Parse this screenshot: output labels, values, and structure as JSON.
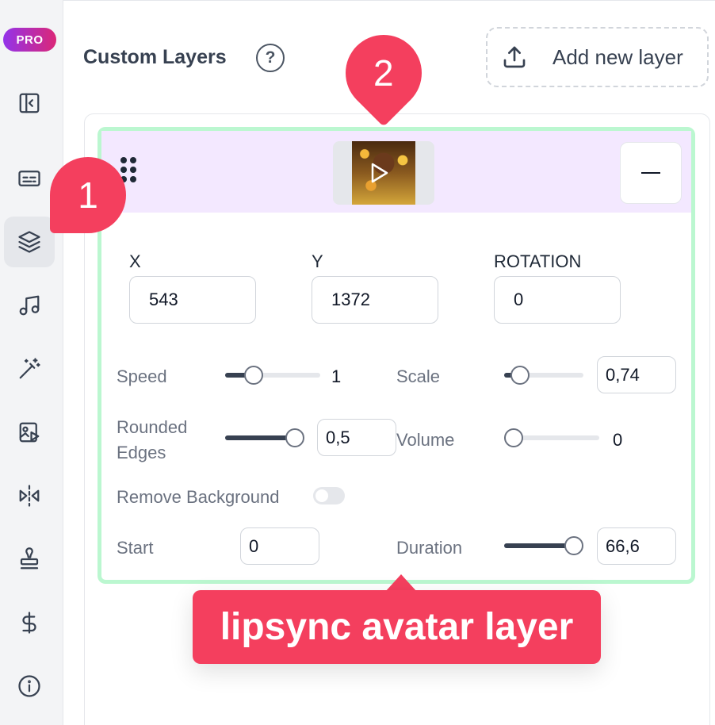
{
  "sidebar": {
    "pro_badge": "PRO",
    "items": [
      {
        "name": "sidebar-toggle-icon"
      },
      {
        "name": "subtitles-icon"
      },
      {
        "name": "layers-icon",
        "active": true
      },
      {
        "name": "music-icon"
      },
      {
        "name": "magic-wand-icon"
      },
      {
        "name": "video-image-icon"
      },
      {
        "name": "flip-icon"
      },
      {
        "name": "stamp-icon"
      },
      {
        "name": "dollar-icon"
      },
      {
        "name": "info-icon"
      }
    ]
  },
  "header": {
    "title": "Custom Layers",
    "help_glyph": "?",
    "add_button_label": "Add new layer"
  },
  "layer": {
    "fields": {
      "x_label": "X",
      "x_value": "543",
      "y_label": "Y",
      "y_value": "1372",
      "rotation_label": "ROTATION",
      "rotation_value": "0",
      "speed_label": "Speed",
      "speed_value": "1",
      "scale_label": "Scale",
      "scale_value": "0,74",
      "rounded_label_1": "Rounded",
      "rounded_label_2": "Edges",
      "rounded_value": "0,5",
      "volume_label": "Volume",
      "volume_value": "0",
      "remove_bg_label": "Remove Background",
      "start_label": "Start",
      "start_value": "0",
      "duration_label": "Duration",
      "duration_value": "66,6"
    },
    "sliders": {
      "speed_fraction": 0.25,
      "scale_fraction": 0.1,
      "rounded_fraction": 1.0,
      "volume_fraction": 0.0,
      "duration_fraction": 1.0
    },
    "remove_background_on": false
  },
  "annotations": {
    "marker_1": "1",
    "marker_2": "2",
    "callout": "lipsync avatar layer"
  },
  "colors": {
    "accent": "#f43f5e",
    "card_border": "#bbf7d0",
    "card_header": "#f3e8ff"
  }
}
